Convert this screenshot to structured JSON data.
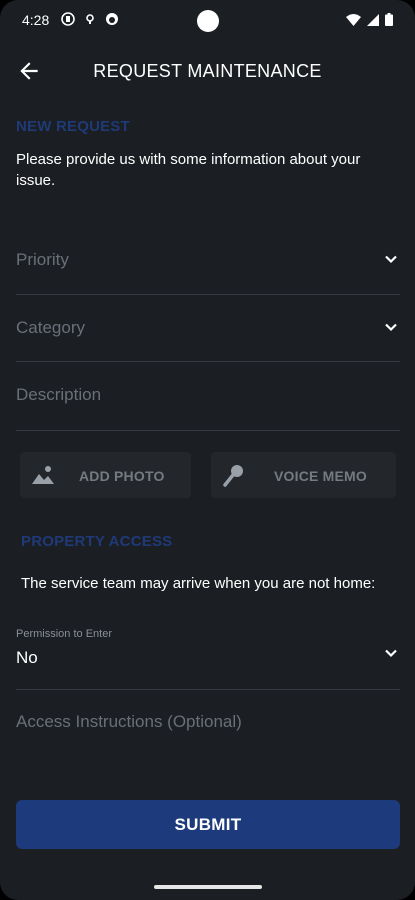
{
  "status_bar": {
    "time": "4:28"
  },
  "app_bar": {
    "title": "REQUEST MAINTENANCE"
  },
  "new_request": {
    "heading": "NEW REQUEST",
    "intro": "Please provide us with some information about your issue.",
    "priority_placeholder": "Priority",
    "category_placeholder": "Category",
    "description_placeholder": "Description"
  },
  "media": {
    "add_photo_label": "ADD PHOTO",
    "voice_memo_label": "VOICE MEMO"
  },
  "property_access": {
    "heading": "PROPERTY ACCESS",
    "intro": "The service team may arrive when you are not home:",
    "permission_label": "Permission to Enter",
    "permission_value": "No",
    "access_instructions_placeholder": "Access Instructions (Optional)"
  },
  "submit_label": "SUBMIT",
  "colors": {
    "background": "#1b1e22",
    "accent": "#1f3a78",
    "button": "#1d3b7c",
    "placeholder": "#6a6f78"
  },
  "icons": [
    "arrow-back-icon",
    "chevron-down-icon",
    "photo-icon",
    "microphone-icon",
    "wifi-icon",
    "signal-icon",
    "battery-icon"
  ]
}
